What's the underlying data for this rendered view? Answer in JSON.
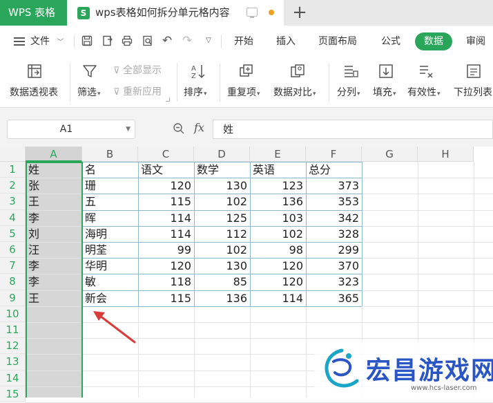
{
  "titlebar": {
    "app_name": "WPS 表格",
    "doc_icon_letter": "S",
    "doc_title": "wps表格如何拆分单元格内容"
  },
  "menubar": {
    "file_label": "文件",
    "tabs": [
      "开始",
      "插入",
      "页面布局",
      "公式",
      "数据",
      "审阅"
    ],
    "active_tab": "数据"
  },
  "ribbon": {
    "pivot": "数据透视表",
    "filter": "筛选",
    "show_all": "全部显示",
    "reapply": "重新应用",
    "sort": "排序",
    "duplicates": "重复项",
    "compare": "数据对比",
    "split": "分列",
    "fill": "填充",
    "validity": "有效性",
    "dropdown": "下拉列表"
  },
  "formula_bar": {
    "cell_ref": "A1",
    "fx_label": "fx",
    "content": "姓"
  },
  "grid": {
    "columns": [
      "A",
      "B",
      "C",
      "D",
      "E",
      "F",
      "G",
      "H"
    ],
    "rows": [
      "1",
      "2",
      "3",
      "4",
      "5",
      "6",
      "7",
      "8",
      "9",
      "10",
      "11",
      "12",
      "13",
      "14",
      "15"
    ],
    "header_row": [
      "姓",
      "名",
      "语文",
      "数学",
      "英语",
      "总分"
    ],
    "data": [
      [
        "张",
        "珊",
        "120",
        "130",
        "123",
        "373"
      ],
      [
        "王",
        "五",
        "115",
        "102",
        "136",
        "353"
      ],
      [
        "李",
        "晖",
        "114",
        "125",
        "103",
        "342"
      ],
      [
        "刘",
        "海明",
        "114",
        "112",
        "102",
        "328"
      ],
      [
        "汪",
        "明荃",
        "99",
        "102",
        "98",
        "299"
      ],
      [
        "李",
        "华明",
        "120",
        "130",
        "120",
        "370"
      ],
      [
        "李",
        "敏",
        "118",
        "85",
        "120",
        "323"
      ],
      [
        "王",
        "新会",
        "115",
        "136",
        "114",
        "365"
      ]
    ]
  },
  "watermark": {
    "text": "宏昌游戏网",
    "url": "www.hcs-laser.com"
  },
  "colors": {
    "accent": "#2aa65b",
    "annotation_arrow": "#d93a3a",
    "watermark_blue": "#2a55c5"
  }
}
